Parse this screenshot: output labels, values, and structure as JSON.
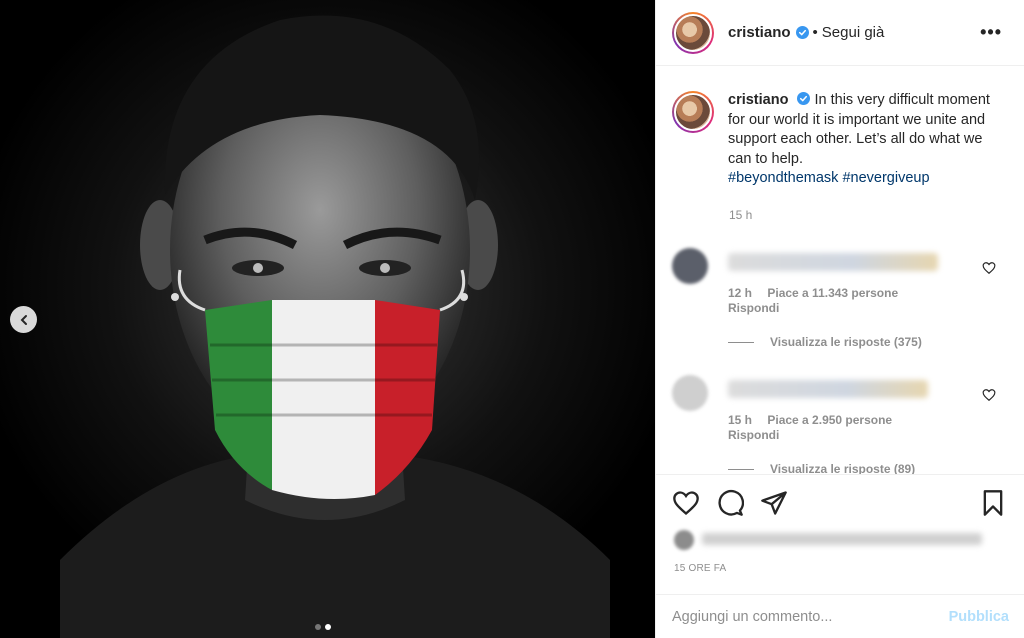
{
  "colors": {
    "verified": "#3897f0",
    "link": "#00376b",
    "muted": "#8e8e8e",
    "publish_disabled": "#b2dffc",
    "flag_green": "#2e8b3a",
    "flag_white": "#f0f0f0",
    "flag_red": "#c8202a"
  },
  "media": {
    "carousel_current": 2,
    "carousel_total": 2,
    "prev_icon": "chevron-left-icon"
  },
  "header": {
    "username": "cristiano",
    "separator": "•",
    "follow_status": "Segui già",
    "more_icon": "ellipsis-icon"
  },
  "caption": {
    "username": "cristiano",
    "text": "In this very difficult moment for our world it is important we unite and support each other. Let’s all do what we can to help.",
    "hashtags": [
      "#beyondthemask",
      "#nevergiveup"
    ],
    "time": "15 h"
  },
  "comments": [
    {
      "time": "12 h",
      "likes": "Piace a 11.343 persone",
      "reply": "Rispondi",
      "view_replies": "Visualizza le risposte (375)"
    },
    {
      "time": "15 h",
      "likes": "Piace a 2.950 persone",
      "reply": "Rispondi",
      "view_replies": "Visualizza le risposte (89)"
    }
  ],
  "actions": {
    "like_icon": "heart-icon",
    "comment_icon": "comment-icon",
    "share_icon": "paper-plane-icon",
    "save_icon": "bookmark-icon"
  },
  "time_ago": "15 ORE FA",
  "add_comment": {
    "placeholder": "Aggiungi un commento...",
    "publish_label": "Pubblica"
  }
}
